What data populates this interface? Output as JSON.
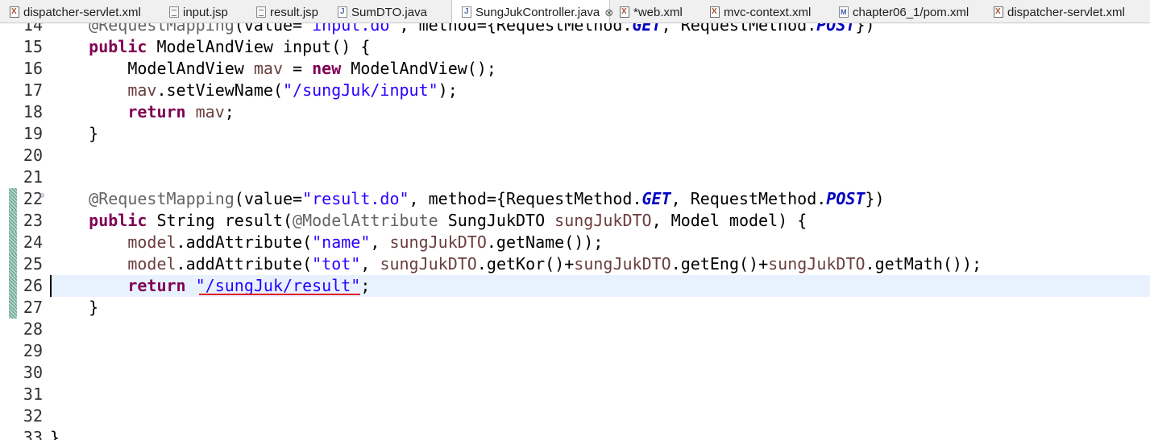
{
  "tabs": [
    {
      "label": "dispatcher-servlet.xml",
      "icon": "xml-file-icon"
    },
    {
      "label": "input.jsp",
      "icon": "jsp-file-icon"
    },
    {
      "label": "result.jsp",
      "icon": "jsp-file-icon"
    },
    {
      "label": "SumDTO.java",
      "icon": "java-file-icon"
    },
    {
      "label": "SungJukController.java",
      "icon": "java-file-icon",
      "active": true,
      "close_glyph": "⊗"
    },
    {
      "label": "*web.xml",
      "icon": "xml-file-icon"
    },
    {
      "label": "mvc-context.xml",
      "icon": "xml-file-icon"
    },
    {
      "label": "chapter06_1/pom.xml",
      "icon": "maven-pom-icon"
    },
    {
      "label": "dispatcher-servlet.xml",
      "icon": "xml-file-icon"
    }
  ],
  "editor": {
    "line_numbers": [
      "14",
      "15",
      "16",
      "17",
      "18",
      "19",
      "20",
      "21",
      "22",
      "23",
      "24",
      "25",
      "26",
      "27",
      "28",
      "29",
      "30",
      "31",
      "32",
      "33"
    ],
    "current_line": "26",
    "change_marked_lines": [
      "22",
      "23",
      "24",
      "25",
      "26",
      "27"
    ],
    "folded_markers": [
      "14",
      "22"
    ],
    "lines": [
      [
        [
          "ann",
          "    @RequestMapping"
        ],
        [
          "",
          "(value="
        ],
        [
          "str",
          "\"input.do\""
        ],
        [
          "",
          ", method={RequestMethod."
        ],
        [
          "st",
          "GET"
        ],
        [
          "",
          ", RequestMethod."
        ],
        [
          "st",
          "POST"
        ],
        [
          "",
          "})"
        ]
      ],
      [
        [
          "kw",
          "    public"
        ],
        [
          "",
          " ModelAndView input() {"
        ]
      ],
      [
        [
          "",
          "        ModelAndView "
        ],
        [
          "var",
          "mav"
        ],
        [
          "",
          " = "
        ],
        [
          "kw",
          "new"
        ],
        [
          "",
          " ModelAndView();"
        ]
      ],
      [
        [
          "var",
          "        mav"
        ],
        [
          "",
          ".setViewName("
        ],
        [
          "str",
          "\"/sungJuk/input\""
        ],
        [
          "",
          ");"
        ]
      ],
      [
        [
          "kw",
          "        return"
        ],
        [
          "",
          " "
        ],
        [
          "var",
          "mav"
        ],
        [
          "",
          ";"
        ]
      ],
      [
        [
          "",
          "    }"
        ]
      ],
      [
        [
          "",
          ""
        ]
      ],
      [
        [
          "",
          ""
        ]
      ],
      [
        [
          "ann",
          "    @RequestMapping"
        ],
        [
          "",
          "(value="
        ],
        [
          "str",
          "\"result.do\""
        ],
        [
          "",
          ", method={RequestMethod."
        ],
        [
          "st",
          "GET"
        ],
        [
          "",
          ", RequestMethod."
        ],
        [
          "st",
          "POST"
        ],
        [
          "",
          "})"
        ]
      ],
      [
        [
          "kw",
          "    public"
        ],
        [
          "",
          " String result("
        ],
        [
          "ann",
          "@ModelAttribute"
        ],
        [
          "",
          " SungJukDTO "
        ],
        [
          "var",
          "sungJukDTO"
        ],
        [
          "",
          ", Model model) {"
        ]
      ],
      [
        [
          "var",
          "        model"
        ],
        [
          "",
          ".addAttribute("
        ],
        [
          "str",
          "\"name\""
        ],
        [
          "",
          ", "
        ],
        [
          "var",
          "sungJukDTO"
        ],
        [
          "",
          ".getName());"
        ]
      ],
      [
        [
          "var",
          "        model"
        ],
        [
          "",
          ".addAttribute("
        ],
        [
          "str",
          "\"tot\""
        ],
        [
          "",
          ", "
        ],
        [
          "var",
          "sungJukDTO"
        ],
        [
          "",
          ".getKor()+"
        ],
        [
          "var",
          "sungJukDTO"
        ],
        [
          "",
          ".getEng()+"
        ],
        [
          "var",
          "sungJukDTO"
        ],
        [
          "",
          ".getMath());"
        ]
      ],
      [
        [
          "kw",
          "        return"
        ],
        [
          "",
          " "
        ],
        [
          "str",
          "\"/sungJuk/result\""
        ],
        [
          "",
          ";"
        ]
      ],
      [
        [
          "",
          "    }"
        ]
      ],
      [
        [
          "",
          ""
        ]
      ],
      [
        [
          "",
          ""
        ]
      ],
      [
        [
          "",
          ""
        ]
      ],
      [
        [
          "",
          ""
        ]
      ],
      [
        [
          "",
          ""
        ]
      ],
      [
        [
          "",
          "}"
        ]
      ]
    ]
  },
  "annotation": {
    "underline_color": "#e02020",
    "underlined_text": "\"/sungJuk/result\""
  }
}
